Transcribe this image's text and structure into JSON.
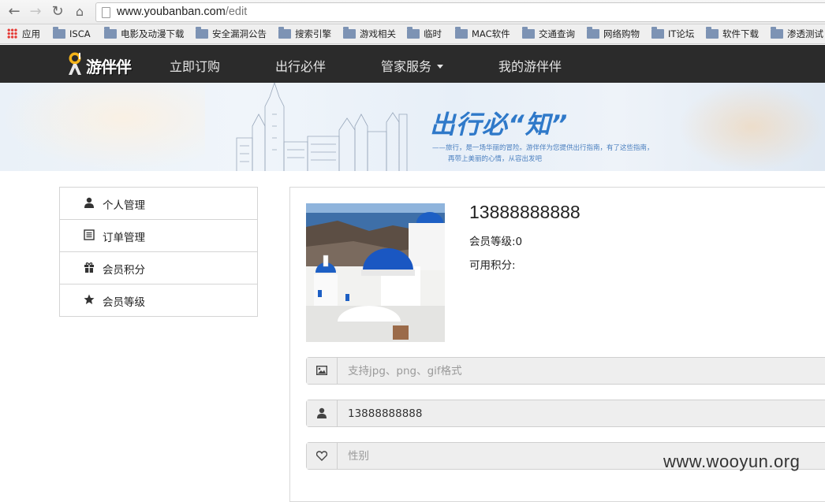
{
  "browser": {
    "url_host": "www.youbanban.com",
    "url_path": "/edit",
    "apps_label": "应用",
    "bookmarks": [
      "ISCA",
      "电影及动漫下载",
      "安全漏洞公告",
      "搜索引擎",
      "游戏相关",
      "临时",
      "MAC软件",
      "交通查询",
      "网络购物",
      "IT论坛",
      "软件下载",
      "渗透测试"
    ]
  },
  "site_nav": {
    "logo_text": "游伴伴",
    "items": [
      "立即订购",
      "出行必伴",
      "管家服务",
      "我的游伴伴"
    ]
  },
  "banner": {
    "title": "出行必“知”",
    "subtitle_line1": "——旅行，是一场华丽的冒险。游伴伴为您提供出行指南，有了这些指南，",
    "subtitle_line2": "再带上美丽的心情，从容出发吧"
  },
  "sidebar": {
    "items": [
      {
        "label": "个人管理",
        "icon": "user-icon"
      },
      {
        "label": "订单管理",
        "icon": "list-icon"
      },
      {
        "label": "会员积分",
        "icon": "gift-icon"
      },
      {
        "label": "会员等级",
        "icon": "star-icon"
      }
    ]
  },
  "profile": {
    "phone": "13888888888",
    "level_label": "会员等级:0",
    "points_label": "可用积分:"
  },
  "form": {
    "avatar_placeholder": "支持jpg、png、gif格式",
    "username_value": "13888888888",
    "gender_placeholder": "性别"
  },
  "watermark": "www.wooyun.org"
}
